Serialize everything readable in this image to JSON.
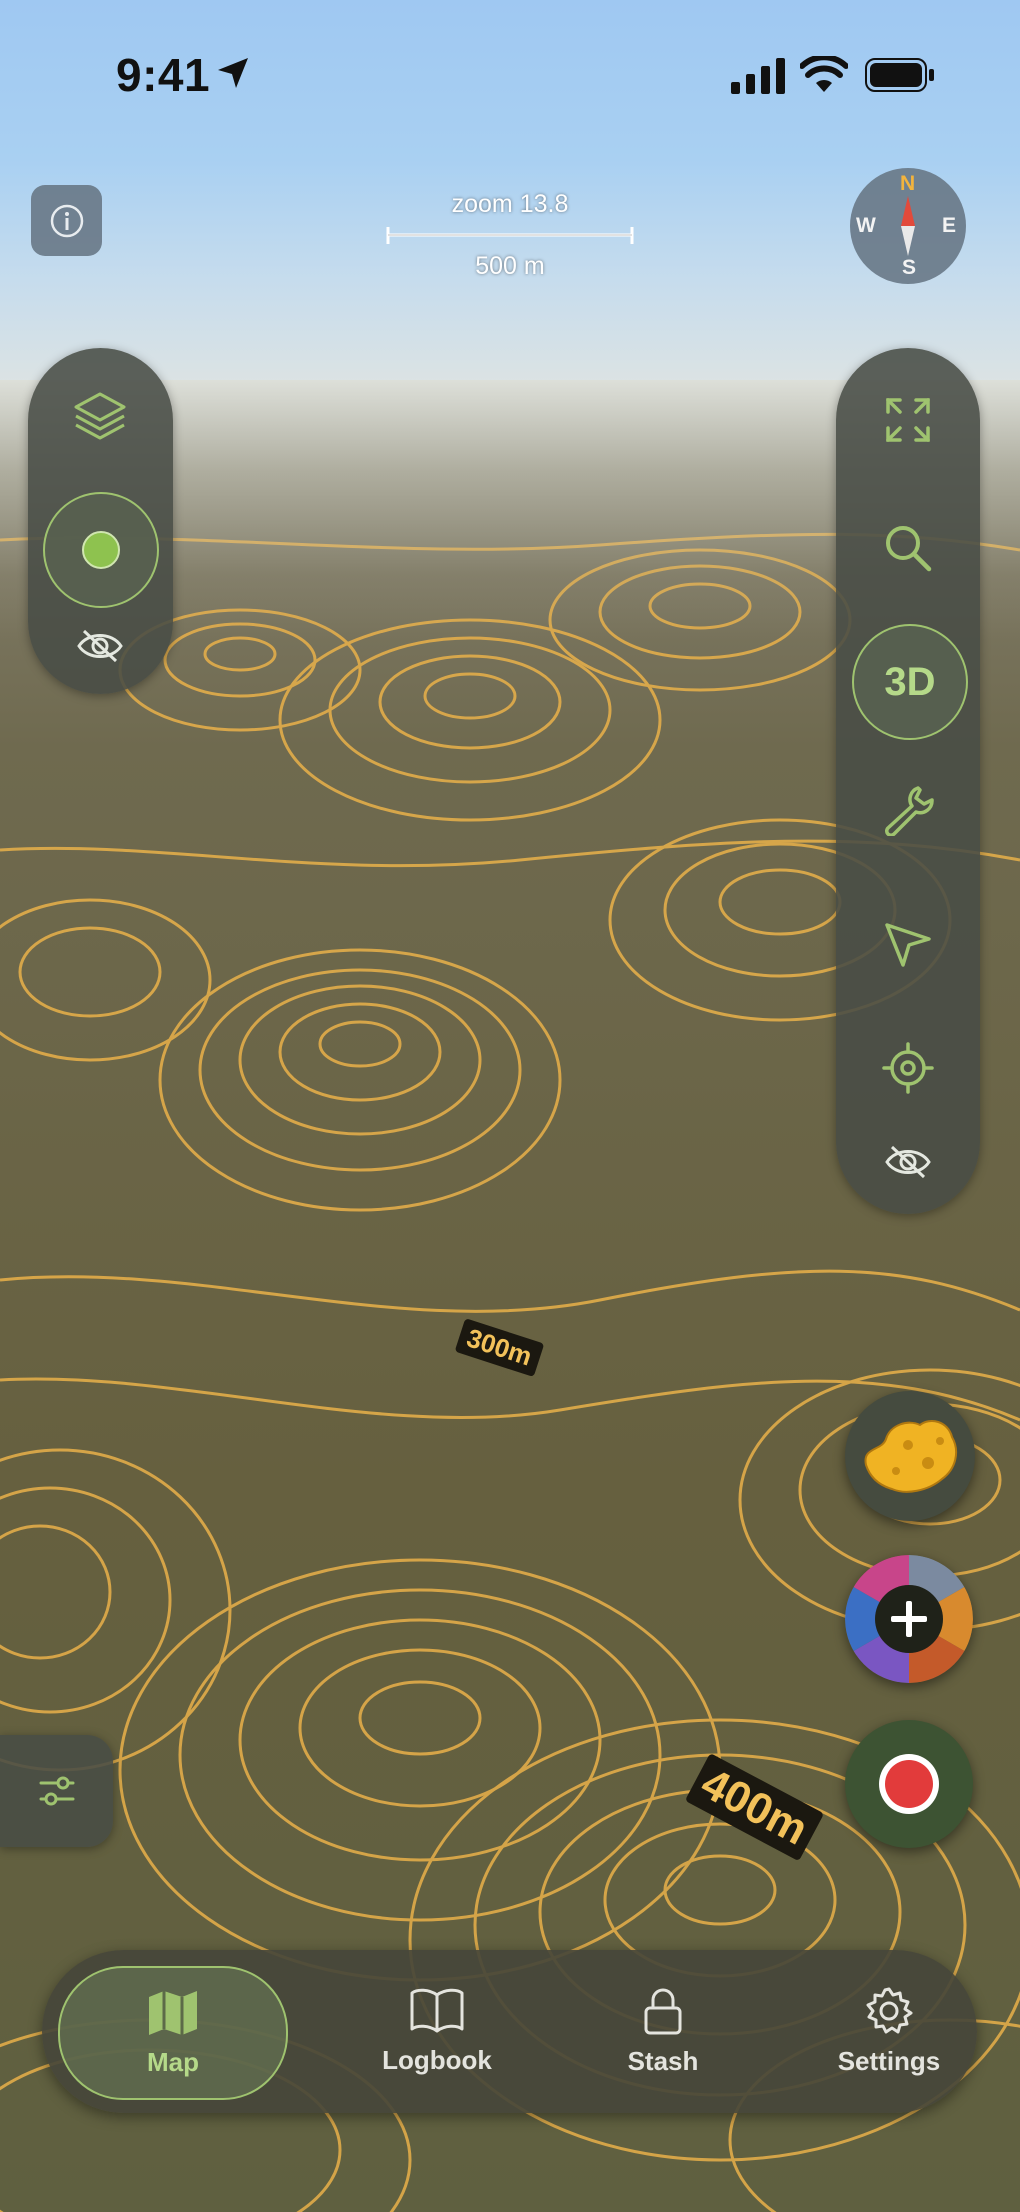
{
  "status_bar": {
    "time": "9:41"
  },
  "map": {
    "zoom_label": "zoom 13.8",
    "scale_label": "500 m",
    "compass": {
      "n": "N",
      "e": "E",
      "s": "S",
      "w": "W"
    },
    "elevation_labels": [
      "300m",
      "400m"
    ],
    "three_d_label": "3D"
  },
  "tabs": [
    {
      "label": "Map",
      "icon": "map-icon",
      "active": true
    },
    {
      "label": "Logbook",
      "icon": "book-icon",
      "active": false
    },
    {
      "label": "Stash",
      "icon": "lock-icon",
      "active": false
    },
    {
      "label": "Settings",
      "icon": "gear-icon",
      "active": false
    }
  ],
  "colors": {
    "accent": "#9fc36f",
    "contour": "#f2c15a",
    "record": "#e23b3b"
  }
}
